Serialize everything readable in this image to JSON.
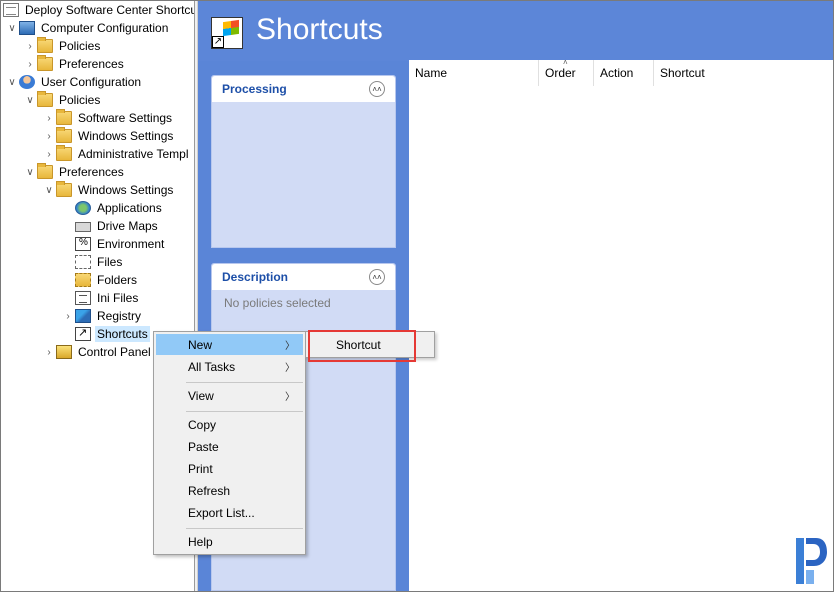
{
  "tree": {
    "items": [
      {
        "label": "Deploy Software Center Shortcut",
        "icon": "document-icon"
      },
      {
        "label": "Computer Configuration",
        "icon": "computer-icon"
      },
      {
        "label": "Policies",
        "icon": "folder-icon"
      },
      {
        "label": "Preferences",
        "icon": "folder-icon"
      },
      {
        "label": "User Configuration",
        "icon": "user-icon"
      },
      {
        "label": "Policies",
        "icon": "folder-icon"
      },
      {
        "label": "Software Settings",
        "icon": "folder-icon"
      },
      {
        "label": "Windows Settings",
        "icon": "folder-icon"
      },
      {
        "label": "Administrative Templ",
        "icon": "folder-icon"
      },
      {
        "label": "Preferences",
        "icon": "folder-icon"
      },
      {
        "label": "Windows Settings",
        "icon": "folder-icon"
      },
      {
        "label": "Applications",
        "icon": "globe-icon"
      },
      {
        "label": "Drive Maps",
        "icon": "drive-icon"
      },
      {
        "label": "Environment",
        "icon": "environment-icon"
      },
      {
        "label": "Files",
        "icon": "files-icon"
      },
      {
        "label": "Folders",
        "icon": "folders-icon"
      },
      {
        "label": "Ini Files",
        "icon": "ini-file-icon"
      },
      {
        "label": "Registry",
        "icon": "registry-icon"
      },
      {
        "label": "Shortcuts",
        "icon": "shortcut-icon"
      },
      {
        "label": "Control Panel",
        "icon": "control-panel-icon"
      }
    ]
  },
  "header": {
    "title": "Shortcuts"
  },
  "processing_panel": {
    "title": "Processing"
  },
  "description_panel": {
    "title": "Description",
    "text": "No policies selected"
  },
  "list": {
    "columns": [
      "Name",
      "Order",
      "Action",
      "Shortcut"
    ]
  },
  "context_menu": {
    "items": [
      "New",
      "All Tasks",
      "View",
      "Copy",
      "Paste",
      "Print",
      "Refresh",
      "Export List...",
      "Help"
    ]
  },
  "submenu": {
    "item": "Shortcut"
  },
  "colors": {
    "header_blue": "#5c86d8",
    "menu_highlight": "#91c9f7",
    "callout_red": "#e53935"
  }
}
